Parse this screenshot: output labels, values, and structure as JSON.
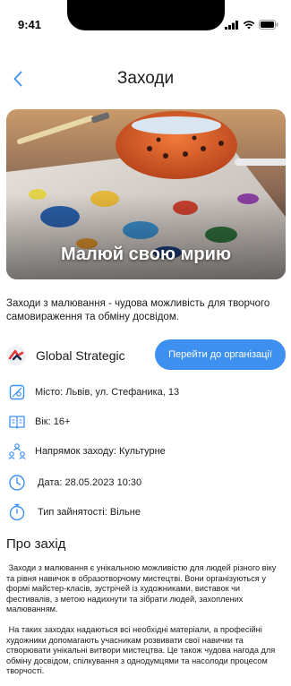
{
  "status_bar": {
    "time": "9:41"
  },
  "header": {
    "title": "Заходи"
  },
  "hero": {
    "caption": "Малюй свою мрию"
  },
  "intro": "Заходи з малювання - чудова можливість для творчого самовираження та обміну досвідом.",
  "organization": {
    "name": "Global Strategic",
    "button_label": "Перейти до організації"
  },
  "details": {
    "city": "Місто: Львів, ул. Стефаника, 13",
    "age": "Вік: 16+",
    "direction": "Напрямок заходу: Культурне",
    "date": "Дата: 28.05.2023 10:30",
    "employment": "Тип зайнятості: Вільне"
  },
  "about": {
    "title": "Про захід",
    "paragraph_1": "Заходи з малювання є унікальною можливістю для людей різного віку та рівня навичок в образотворчому мистецтві. Вони організуються у формі майстер-класів, зустрічей із художниками, виставок чи фестивалів, з метою надихнути та зібрати людей, захоплених малюванням.",
    "paragraph_2": "На таких заходах надаються всі необхідні матеріали, а професійні художники допомагають учасникам розвивати свої навички та створювати унікальні витвори мистецтва. Це також чудова нагода для обміну досвідом, спілкування з однодумцями та насолоди процесом творчості."
  },
  "colors": {
    "accent": "#3d8ff0",
    "icon": "#3d8ff0",
    "text": "#1c1c1e"
  },
  "icons": {
    "back": "chevron-left-icon",
    "city": "map-icon",
    "age": "book-icon",
    "direction": "people-icon",
    "date": "clock-icon",
    "employment": "stopwatch-icon"
  }
}
